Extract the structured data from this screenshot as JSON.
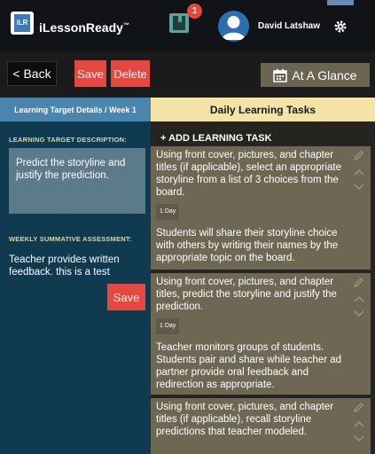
{
  "header": {
    "brand": "iLessonReady",
    "brand_tm": "™",
    "logo_text": "iLR",
    "notification_count": "1",
    "user_name": "David Latshaw"
  },
  "toolbar": {
    "back_label": "< Back",
    "save_label": "Save",
    "delete_label": "Delete",
    "glance_label": "At A Glance"
  },
  "left": {
    "header": "Learning Target Details / Week 1",
    "lt_label": "LEARNING TARGET DESCRIPTION:",
    "lt_text": "Predict the storyline and justify the prediction.",
    "ws_label": "WEEKLY SUMMATIVE ASSESSMENT:",
    "ws_text": "Teacher provides written feedback. this is a test",
    "save_label": "Save"
  },
  "right": {
    "header": "Daily Learning Tasks",
    "add_label": "+ ADD LEARNING TASK",
    "tasks": [
      {
        "text": "Using front cover, pictures, and chapter titles (if applicable), select an appropriate storyline from a list of 3 choices from the board.",
        "duration": "1 Day",
        "detail": "Students will share their storyline choice with others by writing their names by the appropriate topic on the board."
      },
      {
        "text": "Using front cover, pictures, and chapter titles, predict the storyline and justify the prediction.",
        "duration": "1 Day",
        "detail": "Teacher monitors groups of students. Students pair and share while teacher ad partner provide oral feedback and redirection as appropriate."
      },
      {
        "text": "Using front cover, pictures, and chapter titles (if applicable), recall storyline predictions that teacher modeled.",
        "duration": "",
        "detail": ""
      }
    ]
  },
  "colors": {
    "accent_red": "#e54840",
    "left_bg": "#0f3a4f",
    "task_bg": "#6e6754",
    "label_gold": "#e8d58a"
  },
  "icons": [
    "book-icon",
    "avatar-icon",
    "gear-icon",
    "calendar-icon",
    "pencil-icon",
    "chevron-up-icon",
    "chevron-down-icon"
  ]
}
